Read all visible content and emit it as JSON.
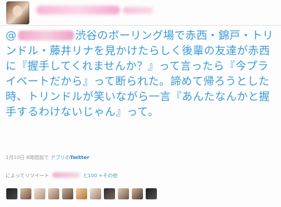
{
  "tweet": {
    "text_after_mention": "渋谷のボーリング場で赤西・錦戸・トリンドル・藤井リナを見かけたらしく後輩の友達が赤西に『握手してくれませんか？』って言ったら『今プライベートだから』って断られた。諦めて帰ろうとした時、トリンドルが笑いながら一言『あんたなんかと握手するわけないじゃん』って。",
    "mention_prefix": "@"
  },
  "meta": {
    "time": "1月10日",
    "ago": "8時間前",
    "via_prefix": "で",
    "app": "アプリ",
    "from": "の",
    "service": "Twitter"
  },
  "retweet": {
    "prefix": "によってリツイート",
    "count_text": "と100 +その他"
  },
  "colors": {
    "text": "#3a9bd8",
    "link": "#4a9fd6",
    "meta": "#9a9a9a"
  }
}
